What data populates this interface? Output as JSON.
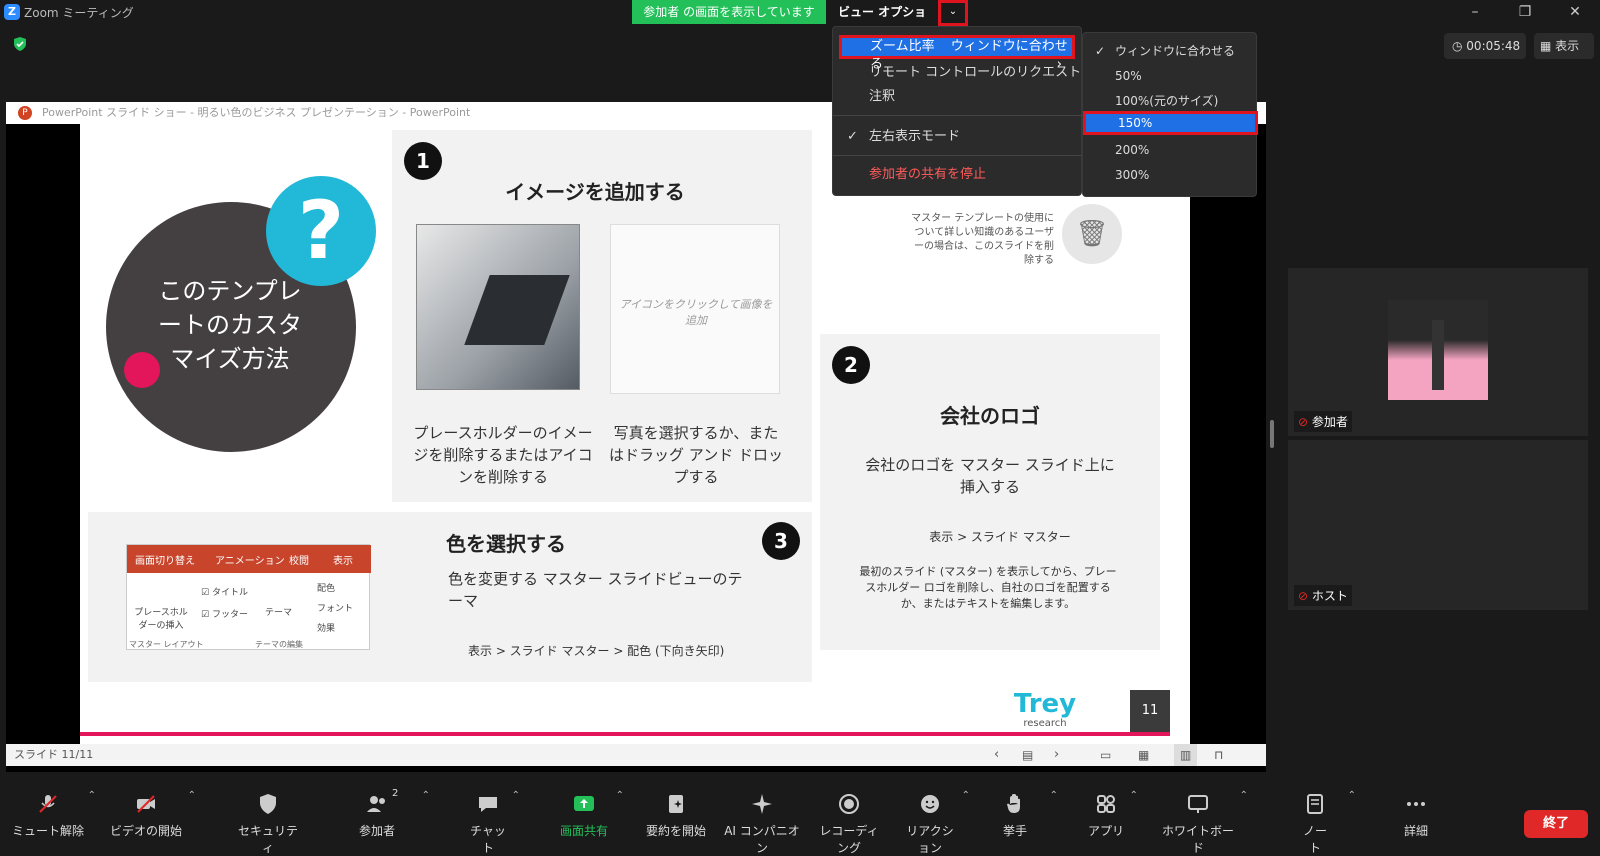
{
  "window": {
    "title": "Zoom ミーティング"
  },
  "share_banner": "参加者 の画面を表示しています",
  "view_options": "ビュー オプション",
  "timer": "00:05:48",
  "view_button": "表示",
  "menu": {
    "zoom_label": "ズーム比率",
    "zoom_value": "ウィンドウに合わせる",
    "remote_control": "リモート コントロールのリクエスト",
    "annotate": "注釈",
    "side_by_side": "左右表示モード",
    "stop_share": "参加者の共有を停止"
  },
  "zoom_options": [
    "ウィンドウに合わせる",
    "50%",
    "100%(元のサイズ)",
    "150%",
    "200%",
    "300%"
  ],
  "pp": {
    "title": "PowerPoint スライド ショー  -  明るい色のビジネス プレゼンテーション - PowerPoint",
    "status": "スライド 11/11",
    "page_num": "11"
  },
  "slide": {
    "question": "?",
    "main_title": "このテンプレートのカスタマイズ方法",
    "step1_title": "イメージを追加する",
    "step1_caption_a": "プレースホルダーのイメージを削除するまたはアイコンを削除する",
    "step1_placeholder": "アイコンをクリックして画像を追加",
    "step1_caption_b": "写真を選択するか、またはドラッグ アンド ドロップする",
    "step2_title": "会社のロゴ",
    "step2_body": "会社のロゴを マスター スライド上に挿入する",
    "step2_path": "表示 > スライド マスター",
    "step2_detail": "最初のスライド (マスター) を表示してから、プレースホルダー ロゴを削除し、自社のロゴを配置するか、またはテキストを編集します。",
    "master_note": "マスター テンプレートの使用について詳しい知識のあるユーザーの場合は、このスライドを削除する",
    "step3_title": "色を選択する",
    "step3_body": "色を変更する マスター スライドビューのテーマ",
    "step3_path": "表示 > スライド マスター > 配色 (下向き矢印)",
    "ribbon_tabs": [
      "画面切り替え",
      "アニメーション",
      "校閲",
      "表示"
    ],
    "ribbon_items": [
      "プレースホルダーの挿入",
      "タイトル",
      "フッター",
      "テーマ",
      "配色",
      "フォント",
      "効果"
    ],
    "ribbon_groups": [
      "マスター レイアウト",
      "テーマの編集"
    ],
    "logo_text": "Trey",
    "logo_sub": "research"
  },
  "participants": [
    {
      "name": "参加者"
    },
    {
      "name": "ホスト"
    }
  ],
  "toolbar": [
    {
      "label": "ミュート解除",
      "icon": "mic-off-icon"
    },
    {
      "label": "ビデオの開始",
      "icon": "video-off-icon"
    },
    {
      "label": "セキュリティ",
      "icon": "shield-icon"
    },
    {
      "label": "参加者",
      "icon": "participants-icon",
      "badge": "2"
    },
    {
      "label": "チャット",
      "icon": "chat-icon"
    },
    {
      "label": "画面共有",
      "icon": "share-screen-icon"
    },
    {
      "label": "要約を開始",
      "icon": "summary-icon"
    },
    {
      "label": "AI コンパニオン",
      "icon": "ai-companion-icon"
    },
    {
      "label": "レコーディング",
      "icon": "record-icon"
    },
    {
      "label": "リアクション",
      "icon": "reaction-icon"
    },
    {
      "label": "挙手",
      "icon": "raise-hand-icon"
    },
    {
      "label": "アプリ",
      "icon": "apps-icon"
    },
    {
      "label": "ホワイトボード",
      "icon": "whiteboard-icon"
    },
    {
      "label": "ノート",
      "icon": "notes-icon"
    },
    {
      "label": "詳細",
      "icon": "more-icon"
    }
  ],
  "end_button": "終了",
  "colors": {
    "share_green": "#23c05a",
    "highlight_blue": "#1f6fe5",
    "annotation_red": "#e0141e",
    "accent_cyan": "#22b8d8",
    "accent_pink": "#e3165b"
  }
}
